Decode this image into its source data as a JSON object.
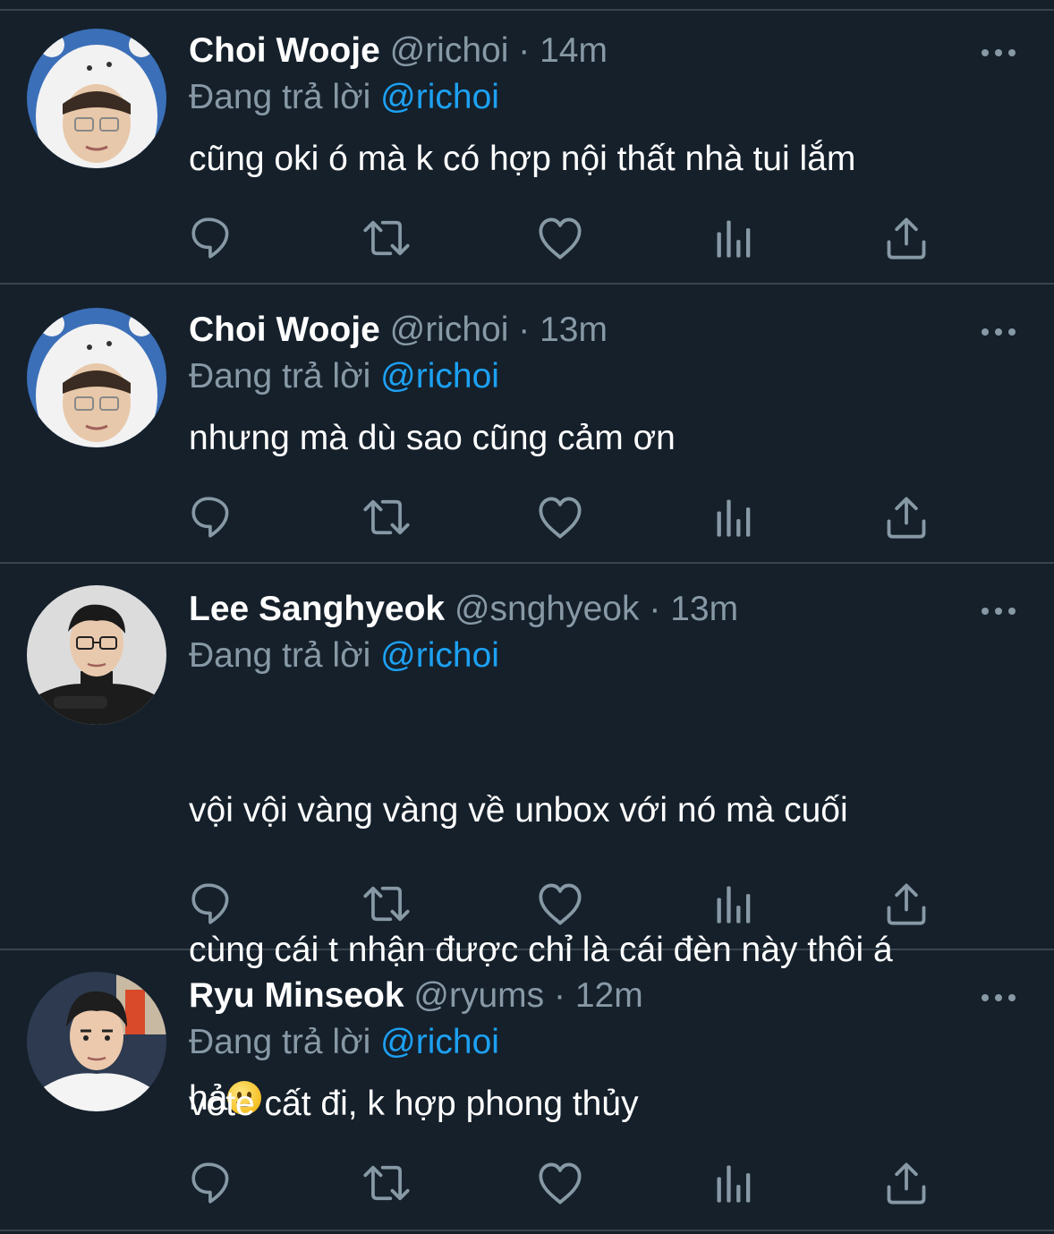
{
  "reply_prefix": "Đang trả lời",
  "tweets": [
    {
      "name": "Choi Wooje",
      "handle": "@richoi",
      "separator": "·",
      "time": "14m",
      "reply_to": "@richoi",
      "text": "cũng oki ó mà k có hợp nội thất nhà tui lắm",
      "avatar": "hooded-person-avatar"
    },
    {
      "name": "Choi Wooje",
      "handle": "@richoi",
      "separator": "·",
      "time": "13m",
      "reply_to": "@richoi",
      "text": "nhưng mà dù sao cũng cảm ơn",
      "avatar": "hooded-person-avatar"
    },
    {
      "name": "Lee Sanghyeok",
      "handle": "@snghyeok",
      "separator": "·",
      "time": "13m",
      "reply_to": "@richoi",
      "text_line1": "vội vội vàng vàng về unbox với nó mà cuối",
      "text_line2": "cùng cái t nhận được chỉ là cái đèn này thôi á",
      "text_line3": "hả",
      "emoji": "slightly-smiling-face",
      "avatar": "glasses-person-avatar"
    },
    {
      "name": "Ryu Minseok",
      "handle": "@ryums",
      "separator": "·",
      "time": "12m",
      "reply_to": "@richoi",
      "text": "vote cất đi, k hợp phong thủy",
      "avatar": "person-avatar"
    }
  ],
  "actions": [
    "reply-icon",
    "retweet-icon",
    "like-icon",
    "analytics-icon",
    "share-icon"
  ],
  "colors": {
    "background": "#15202b",
    "divider": "#38444d",
    "secondary_text": "#8899a6",
    "accent": "#1da1f2",
    "primary_text": "#ffffff"
  }
}
